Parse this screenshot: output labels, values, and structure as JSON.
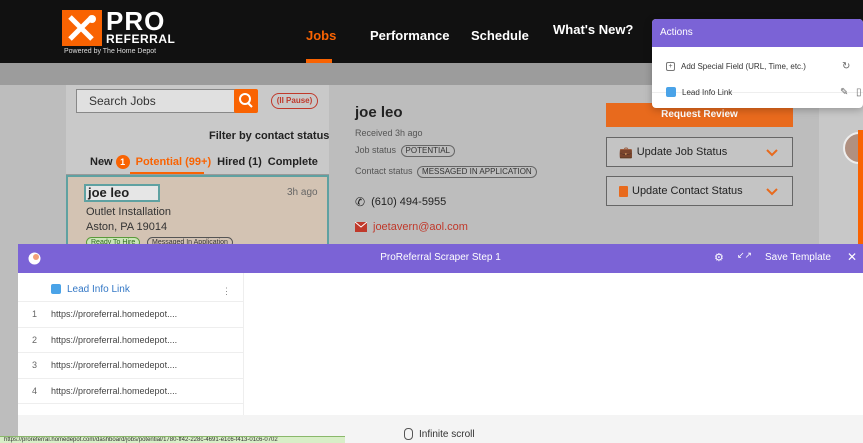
{
  "brand": {
    "logo_word1": "PRO",
    "logo_word2": "REFERRAL",
    "tagline": "Powered by The Home Depot",
    "accent": "#f96302"
  },
  "nav": {
    "items": [
      {
        "label": "Jobs",
        "active": true
      },
      {
        "label": "Performance",
        "active": false
      },
      {
        "label": "Schedule",
        "active": false
      },
      {
        "label": "What's New?",
        "active": false
      }
    ]
  },
  "actions": {
    "title": "Actions",
    "items": [
      {
        "label": "Add Special Field (URL, Time, etc.)",
        "icon": "plus-square-icon"
      },
      {
        "label": "Lead Info Link",
        "icon": "link-icon"
      }
    ]
  },
  "jobs": {
    "search_placeholder": "Search Jobs",
    "pause_label": "(II Pause)",
    "filter_label": "Filter by contact status",
    "tabs": {
      "new": "New",
      "new_count": "1",
      "potential": "Potential (99+)",
      "hired": "Hired (1)",
      "complete": "Complete"
    },
    "card": {
      "name": "joe leo",
      "time": "3h ago",
      "service": "Outlet Installation",
      "location": "Aston, PA 19014",
      "tags": [
        "Ready To Hire",
        "Messaged In Application"
      ]
    }
  },
  "detail": {
    "name": "joe leo",
    "received": "Received 3h ago",
    "job_status_label": "Job status",
    "job_status": "POTENTIAL",
    "contact_status_label": "Contact status",
    "contact_status": "MESSAGED IN APPLICATION",
    "phone": "(610) 494-5955",
    "email": "joetavern@aol.com"
  },
  "side_actions": {
    "request_review": "Request Review",
    "update_job_status": "Update Job Status",
    "update_contact_status": "Update Contact Status"
  },
  "scraper": {
    "title": "ProReferral Scraper Step 1",
    "save_template": "Save Template",
    "column_header": "Lead Info Link",
    "rows": [
      {
        "num": "1",
        "value": "https://proreferral.homedepot...."
      },
      {
        "num": "2",
        "value": "https://proreferral.homedepot...."
      },
      {
        "num": "3",
        "value": "https://proreferral.homedepot...."
      },
      {
        "num": "4",
        "value": "https://proreferral.homedepot...."
      }
    ],
    "footer": "Infinite scroll"
  },
  "status_url": "https://proreferral.homedepot.com/dashboard/jobs/potential/1780-ff42-228c-4691-e1c6-f413-01c6-0702"
}
